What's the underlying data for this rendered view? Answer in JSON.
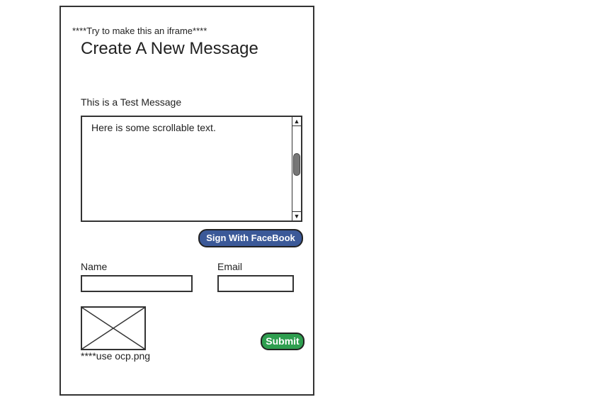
{
  "frame": {
    "note": "****Try to make this an iframe****",
    "title": "Create A New Message"
  },
  "message": {
    "label": "This is a Test Message",
    "scroll_text": "Here is some scrollable text."
  },
  "facebook": {
    "label": "Sign With FaceBook",
    "color": "#3b5998"
  },
  "form": {
    "name_label": "Name",
    "name_value": "",
    "email_label": "Email",
    "email_value": ""
  },
  "image": {
    "icon": "image-placeholder-icon",
    "note": "****use ocp.png"
  },
  "submit": {
    "label": "Submit",
    "color": "#2e9e4f"
  },
  "scrollbar": {
    "up_arrow": "▲",
    "down_arrow": "▼"
  }
}
